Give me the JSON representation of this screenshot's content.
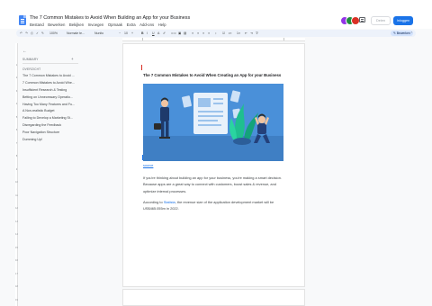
{
  "header": {
    "doc_title": "The 7 Common Mistakes to Avoid When Building an App for your Business",
    "menus": [
      "Bestand",
      "Bewerken",
      "Bekijken",
      "Invoegen",
      "Opmaak",
      "Extra",
      "Add-ons",
      "Help"
    ],
    "ghost_button": "Delen",
    "share_button": "Inloggen"
  },
  "toolbar": {
    "zoom": "100%",
    "style": "Normale te...",
    "font": "Nunito",
    "size": "10",
    "mode": "Bewerken"
  },
  "outline": {
    "summary_label": "SUMMARY",
    "outline_label": "OVERZICHT",
    "items": [
      "The 7 Common Mistakes to Avoid ...",
      "7 Common Mistakes to Avoid Whe...",
      "Insufficient Research & Testing",
      "Betting on Unnecessary Operatio...",
      "Having Too Many Features and Fu...",
      "A Non-realistic Budget",
      "Failing to Develop a Marketing St...",
      "Disregarding the Feedback",
      "Poor Navigation Structure",
      "Dumming Up!"
    ]
  },
  "document": {
    "heading": "The 7 Common Mistakes to Avoid When Creating an App for your Business",
    "source": "source",
    "para1": "If you're thinking about building an app for your business, you're making a smart decision. Because apps are a great way to connect with customers, boost sales & revenue, and optimize internal processes.",
    "para2_before": "According to ",
    "para2_link": "Statista",
    "para2_after": ", the revenue size of the application development market will be US$465.055m in 2022."
  },
  "colors": {
    "accent": "#1a73e8",
    "hero_bg": "#4a90d9",
    "doc_icon": "#4285f4"
  }
}
